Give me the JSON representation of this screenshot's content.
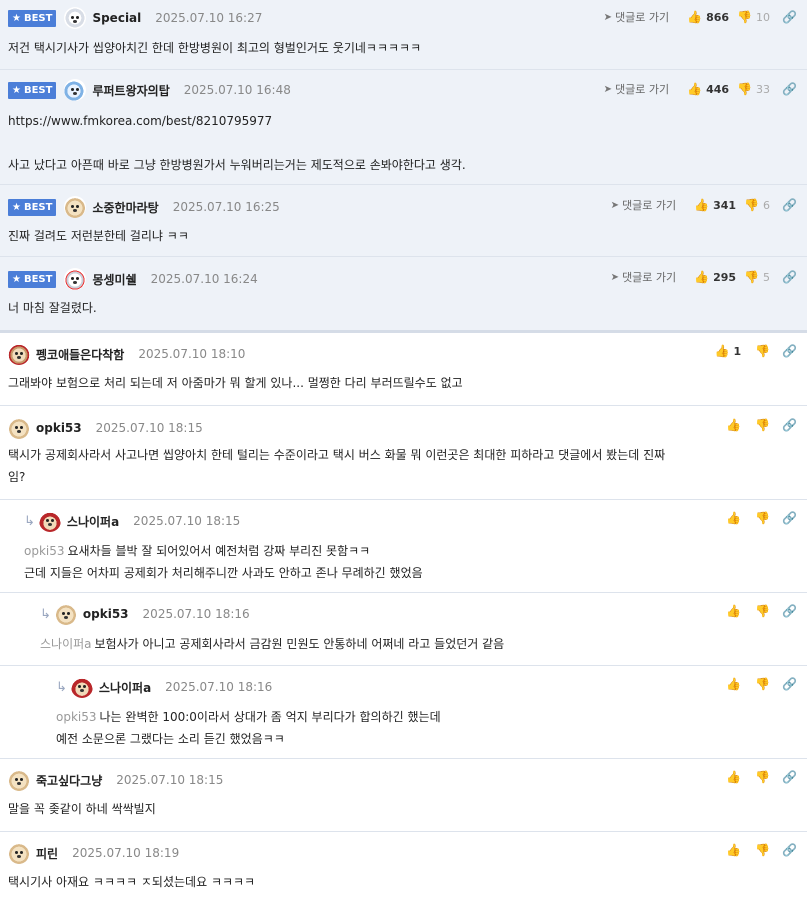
{
  "best_badge": "BEST",
  "goto_label": "댓글로 가기",
  "best_comments": [
    {
      "nick": "Special",
      "date": "2025.07.10 16:27",
      "up": "866",
      "down": "10",
      "text": "저건 택시기사가 씹양아치긴 한데 한방병원이 최고의 형벌인거도 웃기네ㅋㅋㅋㅋㅋ"
    },
    {
      "nick": "루퍼트왕자의탑",
      "date": "2025.07.10 16:48",
      "up": "446",
      "down": "33",
      "text_lines": [
        "https://www.fmkorea.com/best/8210795977",
        "",
        "사고 났다고 아픈때 바로 그냥 한방병원가서 누워버리는거는 제도적으로 손봐야한다고 생각."
      ]
    },
    {
      "nick": "소중한마라탕",
      "date": "2025.07.10 16:25",
      "up": "341",
      "down": "6",
      "text": "진짜 걸려도 저런분한테 걸리냐 ㅋㅋ"
    },
    {
      "nick": "몽셍미쉘",
      "date": "2025.07.10 16:24",
      "up": "295",
      "down": "5",
      "text": "너 마침 잘걸렸다."
    }
  ],
  "comments": [
    {
      "nick": "펭코애들은다착함",
      "date": "2025.07.10 18:10",
      "up": "1",
      "text": "그래봐야 보험으로 처리 되는데 저 아줌마가 뭐 할게 있나... 멀쩡한 다리 부러뜨릴수도 없고"
    },
    {
      "nick": "opki53",
      "date": "2025.07.10 18:15",
      "text_lines": [
        "택시가 공제회사라서 사고나면 씹양아치 한테 털리는 수준이라고 택시 버스 화물 뭐 이런곳은 최대한 피하라고 댓글에서 봤는데 진짜",
        "임?"
      ]
    },
    {
      "nick": "스나이퍼a",
      "date": "2025.07.10 18:15",
      "mention": "opki53",
      "text_lines": [
        "요새차들 블박 잘 되어있어서 예전처럼 강짜 부리진 못함ㅋㅋ",
        "근데 지들은 어차피 공제회가 처리해주니깐 사과도 안하고 존나 무례하긴 했었음"
      ]
    },
    {
      "nick": "opki53",
      "date": "2025.07.10 18:16",
      "mention": "스나이퍼a",
      "text": "보험사가 아니고 공제회사라서 금감원 민원도 안통하네 어쩌네 라고 들었던거 같음"
    },
    {
      "nick": "스나이퍼a",
      "date": "2025.07.10 18:16",
      "mention": "opki53",
      "text_lines": [
        "나는 완벽한 100:0이라서 상대가 좀 억지 부리다가 합의하긴 했는데",
        "예전 소문으론 그랬다는 소리 듣긴 했었음ㅋㅋ"
      ]
    },
    {
      "nick": "죽고싶다그냥",
      "date": "2025.07.10 18:15",
      "text": "말을 꼭 좆같이 하네 싹싹빌지"
    },
    {
      "nick": "피린",
      "date": "2025.07.10 18:19",
      "text": "택시기사 아재요 ㅋㅋㅋㅋ ㅈ되셨는데요 ㅋㅋㅋㅋ"
    }
  ],
  "icons": {
    "star": "star-icon",
    "goto": "navigation-arrow-icon",
    "up": "thumbs-up-icon",
    "down": "thumbs-down-icon",
    "link": "link-icon",
    "reply": "reply-arrow-icon"
  },
  "colors": {
    "badge": "#4b7ed8",
    "best_bg": "#eef2f8"
  }
}
